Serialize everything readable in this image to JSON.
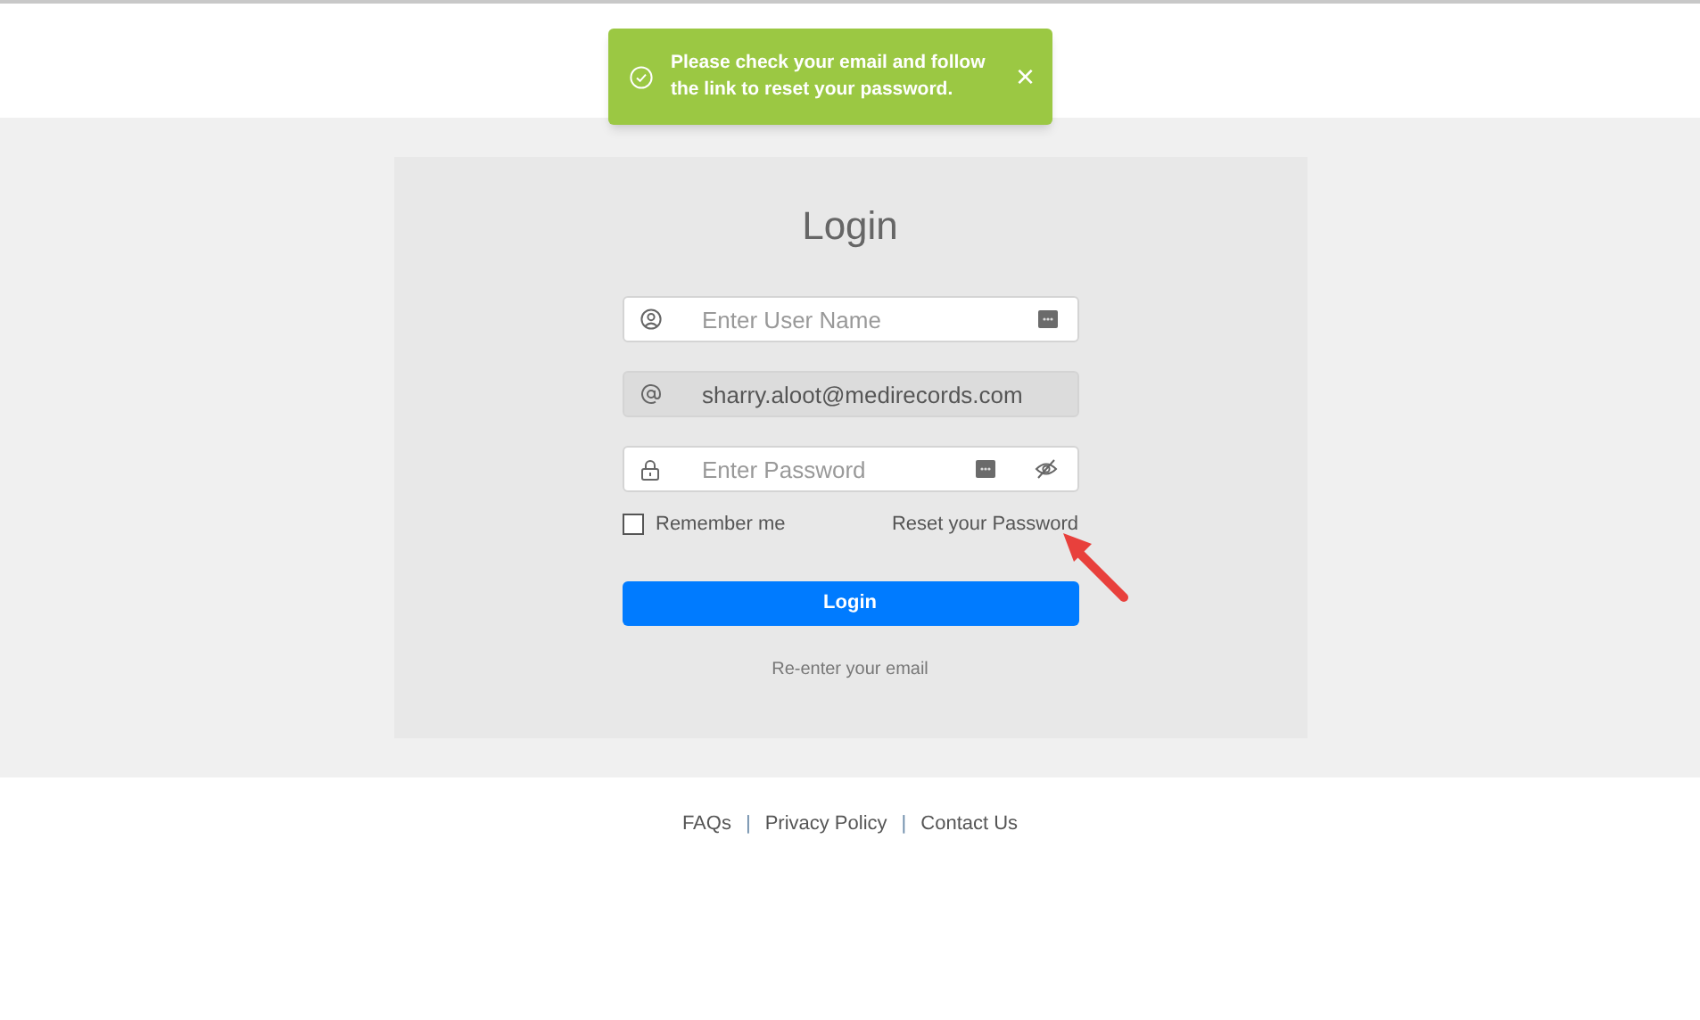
{
  "toast": {
    "message": "Please check your email and follow the link to reset your password.",
    "close": "×"
  },
  "login": {
    "title": "Login",
    "fields": [
      {
        "kind": "user",
        "placeholder": "Enter User Name",
        "disabled": false
      },
      {
        "kind": "email",
        "value": "sharry.aloot@medirecords.com",
        "disabled": true
      },
      {
        "kind": "password",
        "placeholder": "Enter Password",
        "disabled": false
      }
    ],
    "remember": {
      "label": "Remember me",
      "checked": false
    },
    "reset_link": "Reset your Password",
    "button": "Login",
    "reenter_link": "Re-enter your email"
  },
  "footer": {
    "links": [
      "FAQs",
      "Privacy Policy",
      "Contact Us"
    ],
    "separator": "|"
  }
}
